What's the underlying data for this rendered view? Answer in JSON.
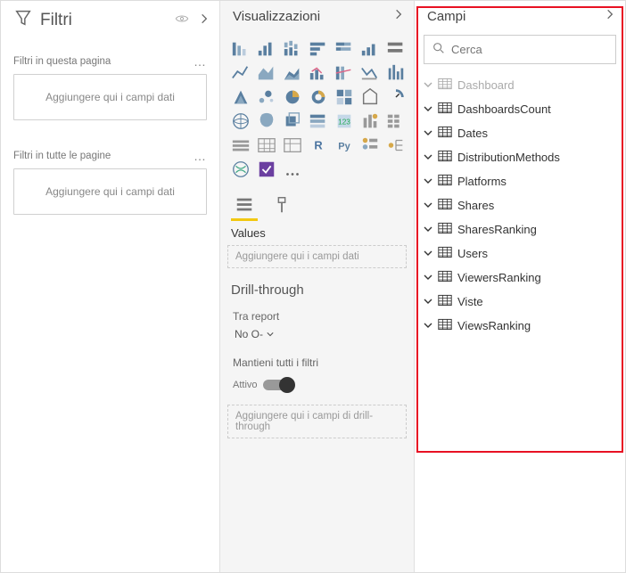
{
  "filters": {
    "title": "Filtri",
    "pageSectionLabel": "Filtri in questa pagina",
    "allPagesSectionLabel": "Filtri in tutte le pagine",
    "dropHint": "Aggiungere qui i campi dati"
  },
  "viz": {
    "title": "Visualizzazioni",
    "valuesLabel": "Values",
    "valuesDropHint": "Aggiungere qui i campi dati",
    "drillThroughTitle": "Drill-through",
    "crossReportLabel": "Tra report",
    "crossReportValue": "No O-",
    "keepFiltersLabel": "Mantieni tutti i filtri",
    "toggleLabel": "Attivo",
    "drillDropHint": "Aggiungere qui i campi di drill-through"
  },
  "fields": {
    "title": "Campi",
    "searchPlaceholder": "Cerca",
    "tables": [
      {
        "name": "Dashboard",
        "dim": true
      },
      {
        "name": "DashboardsCount",
        "dim": false
      },
      {
        "name": "Dates",
        "dim": false
      },
      {
        "name": "DistributionMethods",
        "dim": false
      },
      {
        "name": "Platforms",
        "dim": false
      },
      {
        "name": "Shares",
        "dim": false
      },
      {
        "name": "SharesRanking",
        "dim": false
      },
      {
        "name": "Users",
        "dim": false
      },
      {
        "name": "ViewersRanking",
        "dim": false
      },
      {
        "name": "Viste",
        "dim": false
      },
      {
        "name": "ViewsRanking",
        "dim": false
      }
    ]
  }
}
